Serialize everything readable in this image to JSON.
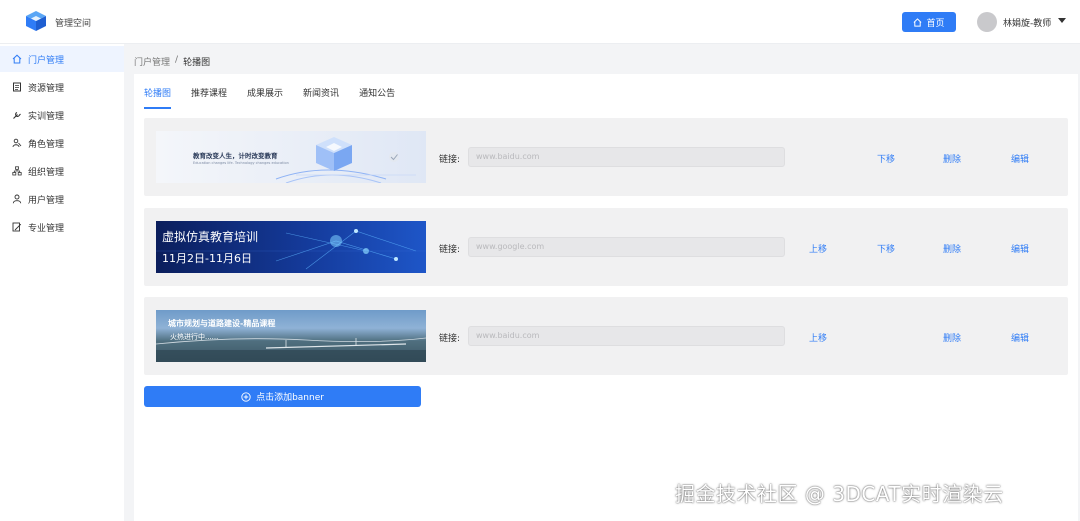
{
  "header": {
    "app_title": "管理空间",
    "home_label": "首页",
    "user_name": "林娟旋-教师"
  },
  "sidebar": {
    "items": [
      {
        "label": "门户管理",
        "icon": "home-icon",
        "active": true
      },
      {
        "label": "资源管理",
        "icon": "document-list-icon",
        "active": false
      },
      {
        "label": "实训管理",
        "icon": "wrench-icon",
        "active": false
      },
      {
        "label": "角色管理",
        "icon": "role-icon",
        "active": false
      },
      {
        "label": "组织管理",
        "icon": "org-tree-icon",
        "active": false
      },
      {
        "label": "用户管理",
        "icon": "user-icon",
        "active": false
      },
      {
        "label": "专业管理",
        "icon": "edit-document-icon",
        "active": false
      }
    ]
  },
  "breadcrumb": {
    "parent": "门户管理",
    "separator": "/",
    "current": "轮播图"
  },
  "tabs": [
    {
      "label": "轮播图",
      "active": true
    },
    {
      "label": "推荐课程",
      "active": false
    },
    {
      "label": "成果展示",
      "active": false
    },
    {
      "label": "新闻资讯",
      "active": false
    },
    {
      "label": "通知公告",
      "active": false
    }
  ],
  "link_label": "链接:",
  "actions": {
    "move_up": "上移",
    "move_down": "下移",
    "delete": "删除",
    "edit": "编辑"
  },
  "banners": [
    {
      "image_text": "教育改变人生，计时改变教育",
      "image_subtext": "Education changes life. Technology changes education",
      "link_placeholder": "www.baidu.com"
    },
    {
      "image_text": "虚拟仿真教育培训",
      "image_subtext": "11月2日-11月6日",
      "link_placeholder": "www.google.com"
    },
    {
      "image_text": "城市规划与道路建设-精品课程",
      "image_subtext": "火热进行中......",
      "link_placeholder": "www.baidu.com"
    }
  ],
  "add_button_label": "点击添加banner",
  "watermark": "掘金技术社区 @ 3DCAT实时渲染云",
  "colors": {
    "accent": "#2f7cf6",
    "page_bg": "#f3f4f6",
    "row_bg": "#f1f1f2"
  }
}
